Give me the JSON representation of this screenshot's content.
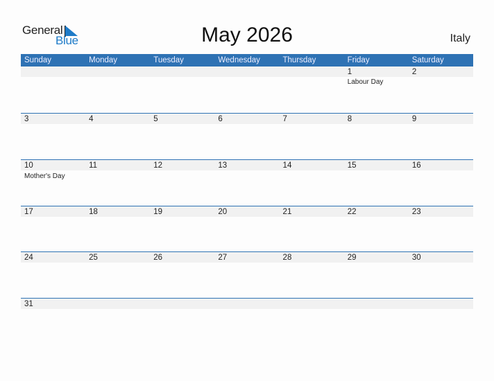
{
  "logo": {
    "line1": "General",
    "line2": "Blue"
  },
  "title": "May 2026",
  "country": "Italy",
  "colors": {
    "header": "#2e72b4",
    "band": "#f1f1f1",
    "brand_blue": "#1e7bc8"
  },
  "weekdays": [
    "Sunday",
    "Monday",
    "Tuesday",
    "Wednesday",
    "Thursday",
    "Friday",
    "Saturday"
  ],
  "weeks": [
    [
      {
        "day": "",
        "event": ""
      },
      {
        "day": "",
        "event": ""
      },
      {
        "day": "",
        "event": ""
      },
      {
        "day": "",
        "event": ""
      },
      {
        "day": "",
        "event": ""
      },
      {
        "day": "1",
        "event": "Labour Day"
      },
      {
        "day": "2",
        "event": ""
      }
    ],
    [
      {
        "day": "3",
        "event": ""
      },
      {
        "day": "4",
        "event": ""
      },
      {
        "day": "5",
        "event": ""
      },
      {
        "day": "6",
        "event": ""
      },
      {
        "day": "7",
        "event": ""
      },
      {
        "day": "8",
        "event": ""
      },
      {
        "day": "9",
        "event": ""
      }
    ],
    [
      {
        "day": "10",
        "event": "Mother's Day"
      },
      {
        "day": "11",
        "event": ""
      },
      {
        "day": "12",
        "event": ""
      },
      {
        "day": "13",
        "event": ""
      },
      {
        "day": "14",
        "event": ""
      },
      {
        "day": "15",
        "event": ""
      },
      {
        "day": "16",
        "event": ""
      }
    ],
    [
      {
        "day": "17",
        "event": ""
      },
      {
        "day": "18",
        "event": ""
      },
      {
        "day": "19",
        "event": ""
      },
      {
        "day": "20",
        "event": ""
      },
      {
        "day": "21",
        "event": ""
      },
      {
        "day": "22",
        "event": ""
      },
      {
        "day": "23",
        "event": ""
      }
    ],
    [
      {
        "day": "24",
        "event": ""
      },
      {
        "day": "25",
        "event": ""
      },
      {
        "day": "26",
        "event": ""
      },
      {
        "day": "27",
        "event": ""
      },
      {
        "day": "28",
        "event": ""
      },
      {
        "day": "29",
        "event": ""
      },
      {
        "day": "30",
        "event": ""
      }
    ],
    [
      {
        "day": "31",
        "event": ""
      },
      {
        "day": "",
        "event": ""
      },
      {
        "day": "",
        "event": ""
      },
      {
        "day": "",
        "event": ""
      },
      {
        "day": "",
        "event": ""
      },
      {
        "day": "",
        "event": ""
      },
      {
        "day": "",
        "event": ""
      }
    ]
  ]
}
